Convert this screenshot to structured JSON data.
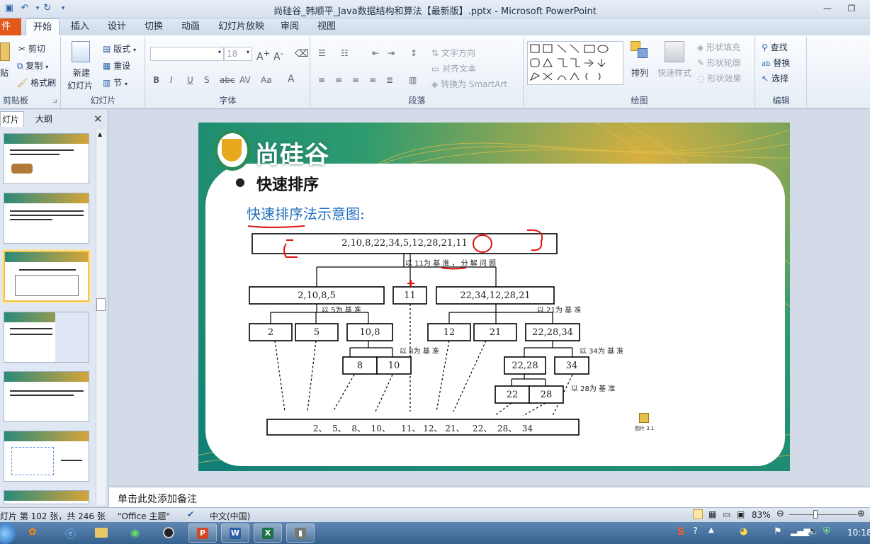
{
  "window": {
    "title": "尚硅谷_韩顺平_Java数据结构和算法【最新版】.pptx - Microsoft PowerPoint"
  },
  "tabs": [
    "件",
    "开始",
    "插入",
    "设计",
    "切换",
    "动画",
    "幻灯片放映",
    "审阅",
    "视图"
  ],
  "ribbon": {
    "clipboard": {
      "paste": "贴",
      "cut": "剪切",
      "copy": "复制",
      "format_painter": "格式刷",
      "label": "剪贴板"
    },
    "slides": {
      "new_slide_1": "新建",
      "new_slide_2": "幻灯片",
      "layout": "版式",
      "reset": "重设",
      "section": "节",
      "label": "幻灯片"
    },
    "font": {
      "size": "18",
      "label": "字体"
    },
    "paragraph": {
      "text_direction": "文字方向",
      "align_text": "对齐文本",
      "smartart": "转换为 SmartArt",
      "label": "段落"
    },
    "drawing": {
      "arrange": "排列",
      "quick_styles": "快速样式",
      "shape_fill": "形状填充",
      "shape_outline": "形状轮廓",
      "shape_effects": "形状效果",
      "label": "绘图"
    },
    "editing": {
      "find": "查找",
      "replace": "替换",
      "select": "选择",
      "label": "编辑"
    }
  },
  "left_pane": {
    "tab_slides": "灯片",
    "tab_outline": "大纲"
  },
  "slide": {
    "logo_text": "尚硅谷",
    "bullet_title": "快速排序",
    "subtitle": "快速排序法示意图:",
    "root": "2,10,8,22,34,5,12,28,21,11",
    "label_11": "以 11为 基 准 ， 分 解 问 题",
    "l1_left": "2,10,8,5",
    "l1_mid": "11",
    "l1_right": "22,34,12,28,21",
    "label_5": "以 5为 基 准",
    "label_21": "以 21为 基 准",
    "l2_a": "2",
    "l2_b": "5",
    "l2_c": "10,8",
    "l2_d": "12",
    "l2_e": "21",
    "l2_f": "22,28,34",
    "label_8": "以 8为 基 准",
    "label_34": "以 34为 基 准",
    "l3_a": "8",
    "l3_b": "10",
    "l3_c": "22,28",
    "l3_d": "34",
    "label_28": "以 28为 基 准",
    "l4_a": "22",
    "l4_b": "28",
    "result": "2、  5、  8、  10、    11、 12、 21、   22、  28、  34",
    "image_caption": "图片 3.1"
  },
  "notes": {
    "placeholder": "单击此处添加备注"
  },
  "status": {
    "slide_info": "灯片 第 102 张，共 246 张",
    "theme": "\"Office 主题\"",
    "language": "中文(中国)",
    "zoom": "83%"
  },
  "taskbar": {
    "time": "10:18"
  },
  "colors": {
    "accent": "#2b5fa8",
    "file_tab": "#e2581c",
    "subtitle": "#1f6fbf",
    "annotation": "#e01010"
  }
}
